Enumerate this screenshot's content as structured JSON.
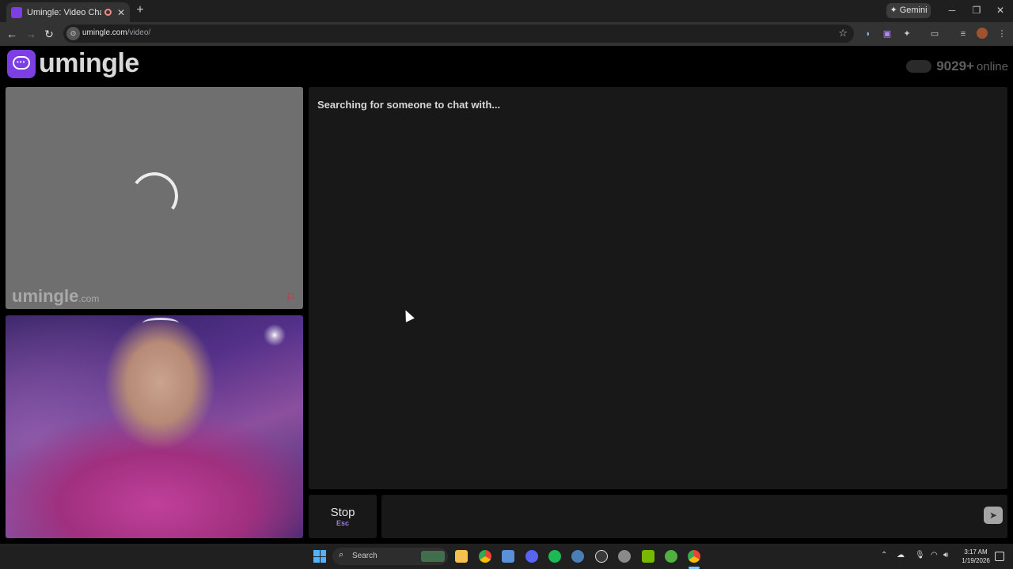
{
  "browser": {
    "tab_title": "Umingle: Video Chat with St",
    "new_tab_symbol": "+",
    "gemini_label": "✦ Gemini",
    "window_controls": [
      "─",
      "❐",
      "✕"
    ],
    "url_host": "umingle.com",
    "url_path": "/video/"
  },
  "site": {
    "logo_text": "umingle",
    "online_count": "9029+",
    "online_label": "online",
    "watermark_name": "umingle",
    "watermark_suffix": ".com",
    "status_message": "Searching for someone to chat with...",
    "stop_label": "Stop",
    "stop_key": "Esc",
    "accent_color": "#7b3fe4"
  },
  "taskbar": {
    "search_label": "Search",
    "time": "3:17 AM",
    "date": "1/19/2026",
    "icons": [
      "file-explorer-icon",
      "chrome-icon",
      "store-icon",
      "discord-icon",
      "spotify-icon",
      "steam-icon",
      "clock-app-icon",
      "settings-icon",
      "nvidia-icon",
      "xbox-icon",
      "chrome-active-icon"
    ]
  }
}
